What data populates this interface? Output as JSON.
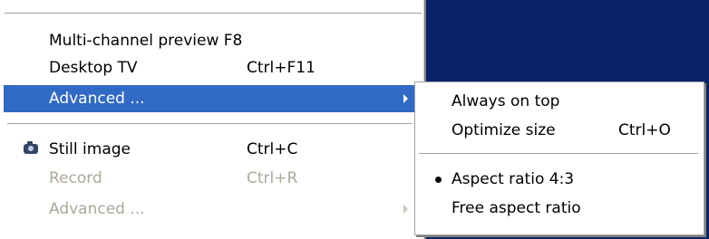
{
  "main_menu": {
    "items": [
      {
        "label": "Multi-channel preview F8",
        "shortcut": ""
      },
      {
        "label": "Desktop TV",
        "shortcut": "Ctrl+F11"
      },
      {
        "label": "Advanced ...",
        "shortcut": ""
      },
      {
        "label": "Still image",
        "shortcut": "Ctrl+C"
      },
      {
        "label": "Record",
        "shortcut": "Ctrl+R"
      },
      {
        "label": "Advanced ...",
        "shortcut": ""
      }
    ]
  },
  "submenu": {
    "items": [
      {
        "label": "Always on top",
        "shortcut": ""
      },
      {
        "label": "Optimize size",
        "shortcut": "Ctrl+O"
      },
      {
        "label": "Aspect ratio 4:3",
        "shortcut": ""
      },
      {
        "label": "Free aspect ratio",
        "shortcut": ""
      }
    ]
  },
  "colors": {
    "highlight": "#316ac5",
    "disabled_text": "#aca899",
    "desktop_blue": "#0a246a"
  }
}
